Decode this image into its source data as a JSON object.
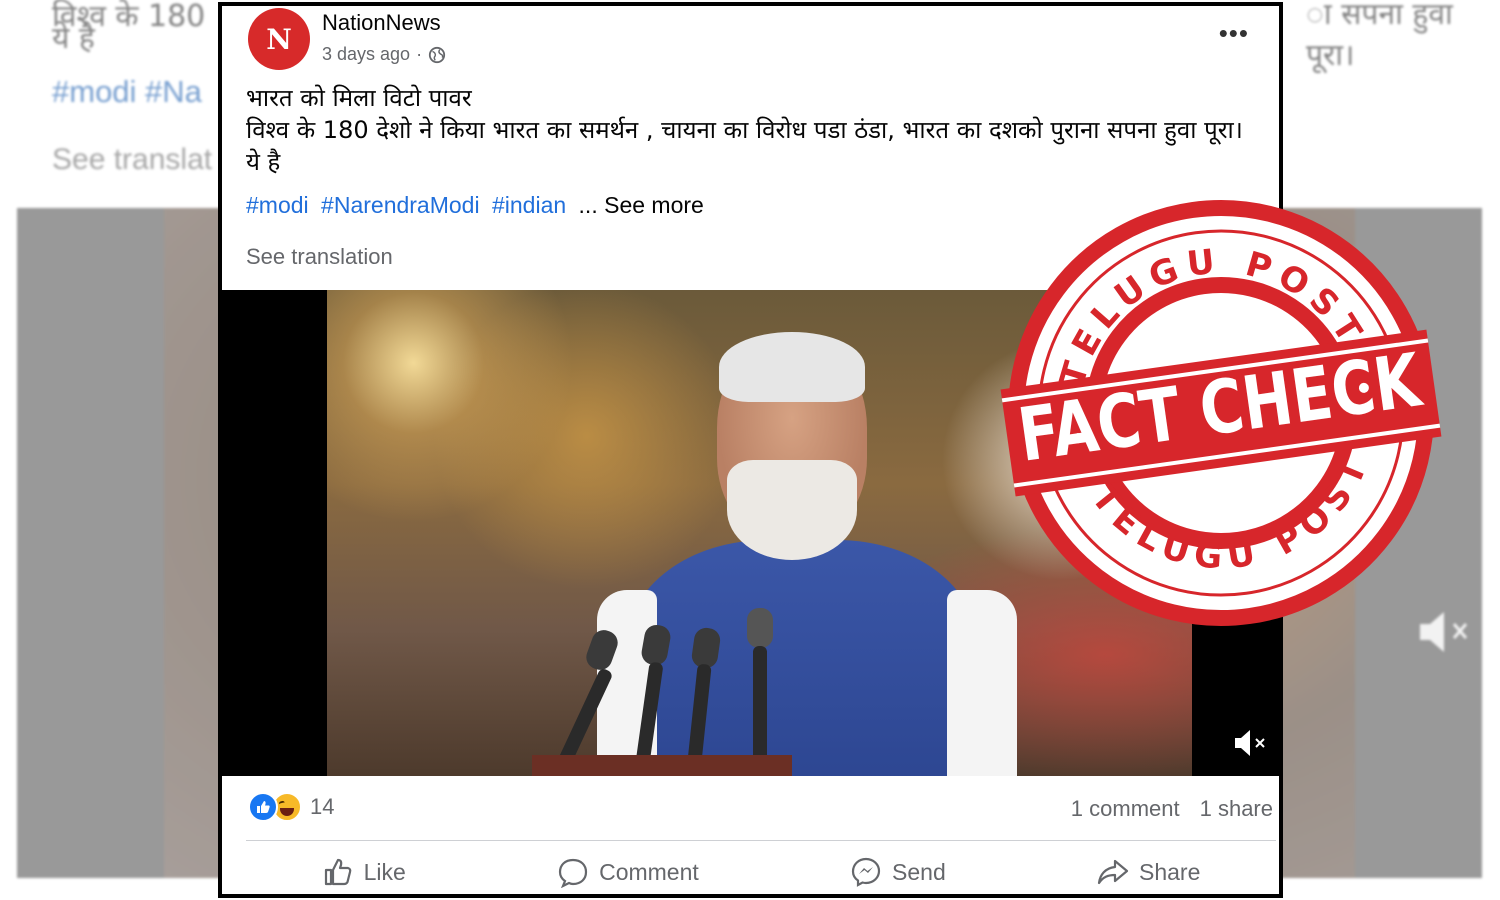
{
  "background_post": {
    "line1": "विश्व के 180",
    "line2": "ये है",
    "right_text": "ा सपना हुवा पूरा।",
    "hashtags": "#modi #Na",
    "see_translation": "See translat"
  },
  "post": {
    "page_name": "NationNews",
    "avatar_letter": "N",
    "time": "3 days ago",
    "text_lines": [
      "भारत को मिला विटो पावर",
      "विश्व के 180 देशो ने किया भारत का समर्थन , चायना का विरोध पडा ठंडा, भारत का दशको पुराना सपना हुवा पूरा।",
      "ये है"
    ],
    "hashtags": [
      "#modi",
      "#NarendraModi",
      "#indian"
    ],
    "ellipsis": "...",
    "see_more": "See more",
    "see_translation": "See translation",
    "reaction_count": "14",
    "comments": "1 comment",
    "shares": "1 share",
    "actions": {
      "like": "Like",
      "comment": "Comment",
      "send": "Send",
      "share": "Share"
    }
  },
  "stamp": {
    "top_text": "TELUGU POST",
    "center_text": "FACT CHECK",
    "bottom_text": "TELUGU POST",
    "color": "#d7262b"
  },
  "colors": {
    "link": "#216fdb",
    "secondary_text": "#65676b",
    "like_blue": "#1877f2"
  },
  "icons": [
    "globe-icon",
    "more-icon",
    "mute-icon",
    "like-icon",
    "haha-icon",
    "thumbs-up-icon",
    "comment-icon",
    "messenger-icon",
    "share-icon"
  ]
}
